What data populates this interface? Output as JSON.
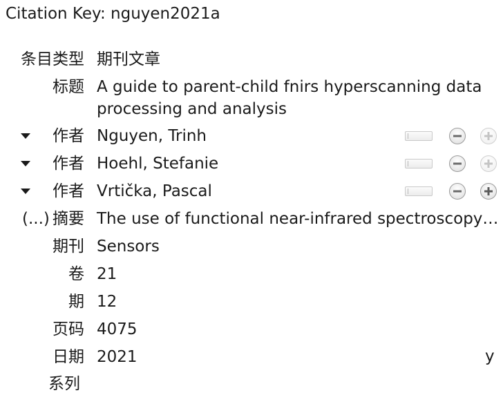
{
  "citation_key": "Citation Key: nguyen2021a",
  "fields": {
    "item_type": {
      "label": "条目类型",
      "value": "期刊文章"
    },
    "title": {
      "label": "标题",
      "value": "A guide to parent-child fnirs hyperscanning data processing and analysis"
    },
    "creators": [
      {
        "label": "作者",
        "value": "Nguyen, Trinh"
      },
      {
        "label": "作者",
        "value": "Hoehl, Stefanie"
      },
      {
        "label": "作者",
        "value": "Vrtička, Pascal"
      }
    ],
    "abstract": {
      "expander": "(...)",
      "label": "摘要",
      "value": "The use of functional near-infrared spectroscopy…"
    },
    "publication": {
      "label": "期刊",
      "value": "Sensors"
    },
    "volume": {
      "label": "卷",
      "value": "21"
    },
    "issue": {
      "label": "期",
      "value": "12"
    },
    "pages": {
      "label": "页码",
      "value": "4075"
    },
    "date": {
      "label": "日期",
      "value": "2021",
      "extra": "y"
    },
    "next_label_partial": "系列"
  },
  "icons": {
    "twisty": "triangle-down-icon",
    "switch": "switch-creator-mode-icon",
    "remove": "minus-circle-icon",
    "add": "plus-circle-icon"
  }
}
